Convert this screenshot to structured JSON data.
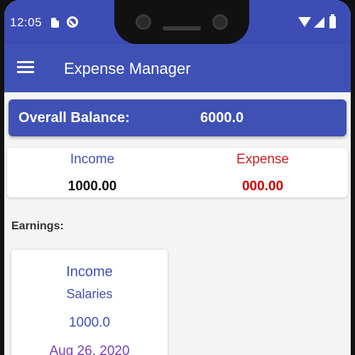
{
  "status_bar": {
    "time": "12:05",
    "icons": [
      "sd-card-icon",
      "do-not-disturb-icon",
      "wifi-icon",
      "signal-icon",
      "battery-icon"
    ]
  },
  "app_bar": {
    "title": "Expense Manager",
    "menu_icon": "hamburger-menu-icon"
  },
  "balance": {
    "label": "Overall Balance:",
    "value": "6000.0"
  },
  "summary": {
    "income_label": "Income",
    "income_value": "1000.00",
    "expense_label": "Expense",
    "expense_value": "000.00"
  },
  "earnings": {
    "title": "Earnings:",
    "items": [
      {
        "type": "Income",
        "category": "Salaries",
        "amount": "1000.0",
        "date": "Aug 26, 2020"
      }
    ]
  },
  "colors": {
    "primary": "#3f51b5",
    "expense": "#cc0000",
    "date": "#7b3fb5",
    "background": "#f4f4f4"
  }
}
